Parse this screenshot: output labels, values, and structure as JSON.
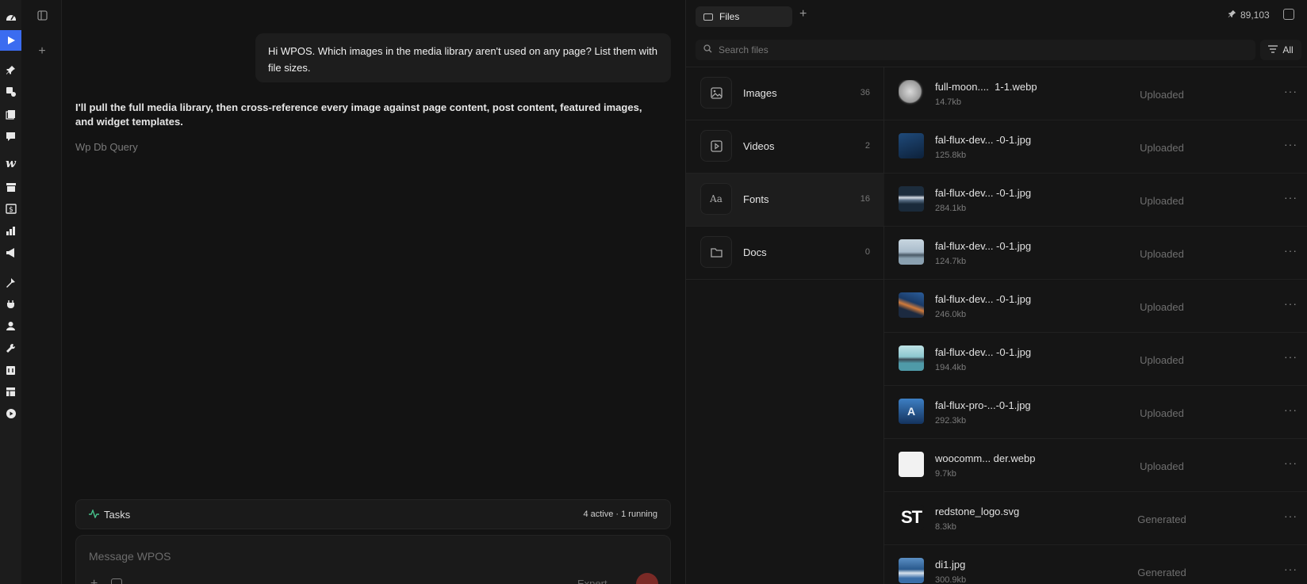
{
  "chat": {
    "user_message": "Hi WPOS. Which images in the media library aren't used on any page? List them with file sizes.",
    "assistant_message": "I'll pull the full media library, then cross-reference every image against page content, post content, featured images, and widget templates.",
    "tool_label": "Wp Db Query",
    "tasks_label": "Tasks",
    "tasks_status": "4 active · 1 running",
    "composer_placeholder": "Message WPOS",
    "composer_mode": "Expert"
  },
  "files": {
    "tab_label": "Files",
    "token_count": "89,103",
    "search_placeholder": "Search files",
    "filter_label": "All",
    "categories": [
      {
        "name": "Images",
        "count": "36",
        "icon": "image-icon"
      },
      {
        "name": "Videos",
        "count": "2",
        "icon": "play-icon"
      },
      {
        "name": "Fonts",
        "count": "16",
        "icon": "font-icon",
        "icon_text": "Aa"
      },
      {
        "name": "Docs",
        "count": "0",
        "icon": "folder-icon"
      }
    ],
    "items": [
      {
        "name": "full-moon....  1-1.webp",
        "size": "14.7kb",
        "status": "Uploaded",
        "thumb_color": "#6f6f6f"
      },
      {
        "name": "fal-flux-dev... -0-1.jpg",
        "size": "125.8kb",
        "status": "Uploaded",
        "thumb_color": "#17355a"
      },
      {
        "name": "fal-flux-dev... -0-1.jpg",
        "size": "284.1kb",
        "status": "Uploaded",
        "thumb_color": "#3b4f66"
      },
      {
        "name": "fal-flux-dev... -0-1.jpg",
        "size": "124.7kb",
        "status": "Uploaded",
        "thumb_color": "#8aa4b6"
      },
      {
        "name": "fal-flux-dev... -0-1.jpg",
        "size": "246.0kb",
        "status": "Uploaded",
        "thumb_color": "#2c4a78"
      },
      {
        "name": "fal-flux-dev... -0-1.jpg",
        "size": "194.4kb",
        "status": "Uploaded",
        "thumb_color": "#6fa7b4"
      },
      {
        "name": "fal-flux-pro-...-0-1.jpg",
        "size": "292.3kb",
        "status": "Uploaded",
        "thumb_color": "#1e4f8a"
      },
      {
        "name": "woocomm... der.webp",
        "size": "9.7kb",
        "status": "Uploaded",
        "thumb_color": "#f2f2f2"
      },
      {
        "name": "redstone_logo.svg",
        "size": "8.3kb",
        "status": "Generated",
        "thumb_color": "#151515",
        "thumb_text": "ST"
      },
      {
        "name": "di1.jpg",
        "size": "300.9kb",
        "status": "Generated",
        "thumb_color": "#3a6ea8"
      }
    ]
  },
  "colors": {
    "accent": "#3b6cf0",
    "tasks_icon": "#46c08a"
  }
}
